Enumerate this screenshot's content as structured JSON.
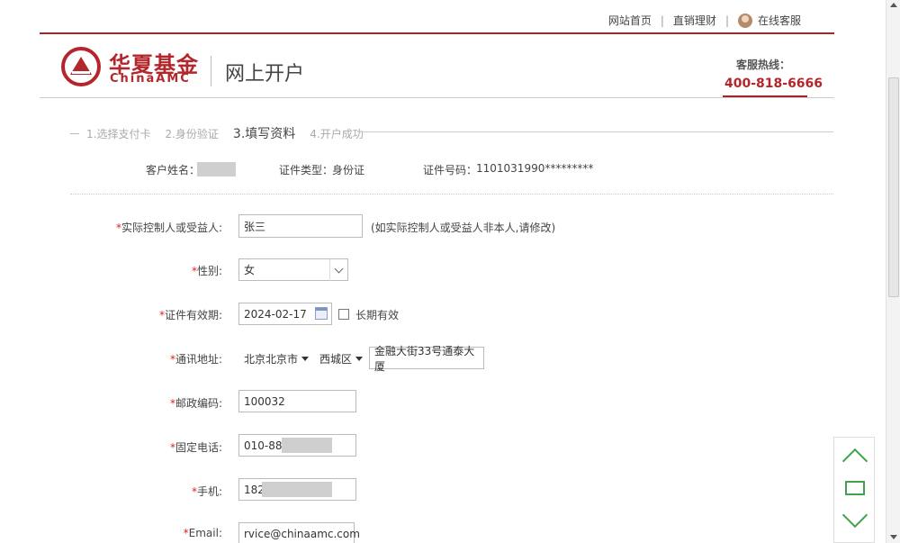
{
  "top_nav": {
    "home": "网站首页",
    "direct_sales": "直销理财",
    "separator": "|",
    "online_service": "在线客服"
  },
  "header": {
    "logo_cn": "华夏基金",
    "logo_en": "ChinaAMC",
    "page_title": "网上开户",
    "hotline_label": "客服热线：",
    "hotline_number": "400-818-6666"
  },
  "steps": [
    {
      "label": "1.选择支付卡"
    },
    {
      "label": "2.身份验证"
    },
    {
      "label": "3.填写资料"
    },
    {
      "label": "4.开户成功"
    }
  ],
  "summary": {
    "name_label": "客户姓名：",
    "id_type_label": "证件类型：",
    "id_type_value": "身份证",
    "id_number_label": "证件号码：",
    "id_number_value": "1101031990*********"
  },
  "form": {
    "beneficiary": {
      "required": "*",
      "label": "实际控制人或受益人:",
      "value": "张三",
      "hint": "(如实际控制人或受益人非本人,请修改)"
    },
    "gender": {
      "required": "*",
      "label": "性别:",
      "value": "女"
    },
    "id_validity": {
      "required": "*",
      "label": "证件有效期:",
      "value": "2024-02-17",
      "long_term_label": "长期有效",
      "long_term_checked": false
    },
    "address": {
      "required": "*",
      "label": "通讯地址:",
      "city": "北京北京市",
      "district": "西城区",
      "street": "金融大街33号通泰大厦"
    },
    "postcode": {
      "required": "*",
      "label": "邮政编码:",
      "value": "100032"
    },
    "landline": {
      "required": "*",
      "label": "固定电话:",
      "value": "010-880"
    },
    "mobile": {
      "required": "*",
      "label": "手机:",
      "value": "182"
    },
    "email": {
      "required": "*",
      "label": "Email:",
      "value": "rvice@chinaamc.com"
    }
  },
  "colors": {
    "brand_red": "#b3262b",
    "required_red": "#dd2222",
    "side_nav_green": "#3fa34d"
  }
}
